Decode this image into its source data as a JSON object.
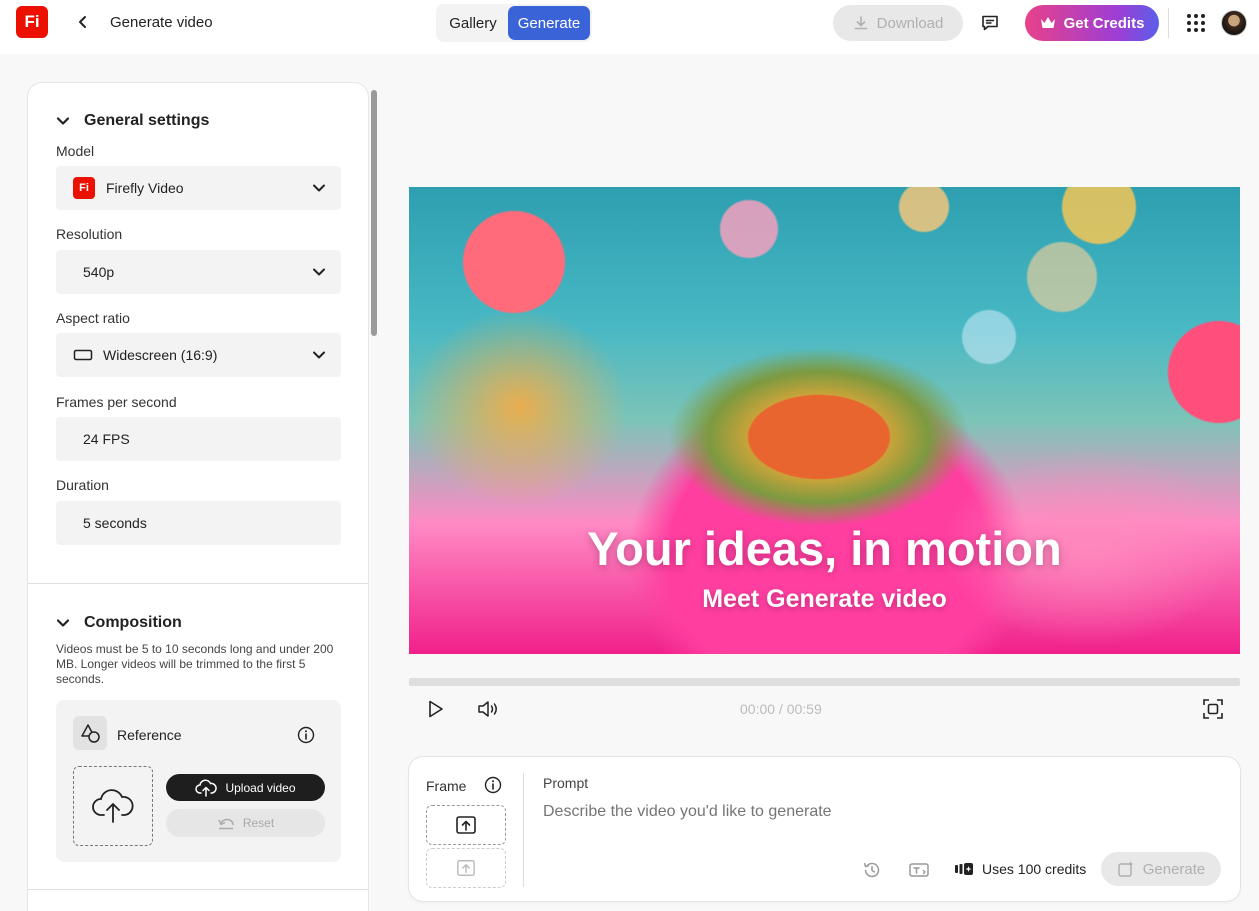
{
  "header": {
    "logo_text": "Fi",
    "page_title": "Generate video",
    "tabs": [
      "Gallery",
      "Generate"
    ],
    "download_label": "Download",
    "get_credits_label": "Get Credits"
  },
  "settings": {
    "general_title": "General settings",
    "model": {
      "label": "Model",
      "value": "Firefly Video",
      "logo_text": "Fi"
    },
    "resolution": {
      "label": "Resolution",
      "value": "540p"
    },
    "aspect_ratio": {
      "label": "Aspect ratio",
      "value": "Widescreen (16:9)"
    },
    "fps": {
      "label": "Frames per second",
      "value": "24 FPS"
    },
    "duration": {
      "label": "Duration",
      "value": "5 seconds"
    },
    "composition_title": "Composition",
    "composition_note": "Videos must be 5 to 10 seconds long and under 200 MB. Longer videos will be trimmed to the first 5 seconds.",
    "reference": {
      "title": "Reference",
      "upload_label": "Upload video",
      "reset_label": "Reset"
    }
  },
  "video": {
    "headline": "Your ideas, in motion",
    "subheadline": "Meet Generate video",
    "time": "00:00 / 00:59"
  },
  "prompt": {
    "frame_label": "Frame",
    "prompt_label": "Prompt",
    "placeholder": "Describe the video you'd like to generate",
    "credits_text": "Uses 100 credits",
    "generate_label": "Generate"
  },
  "colors": {
    "brand_red": "#eb1000",
    "accent_blue": "#3b63d8"
  }
}
